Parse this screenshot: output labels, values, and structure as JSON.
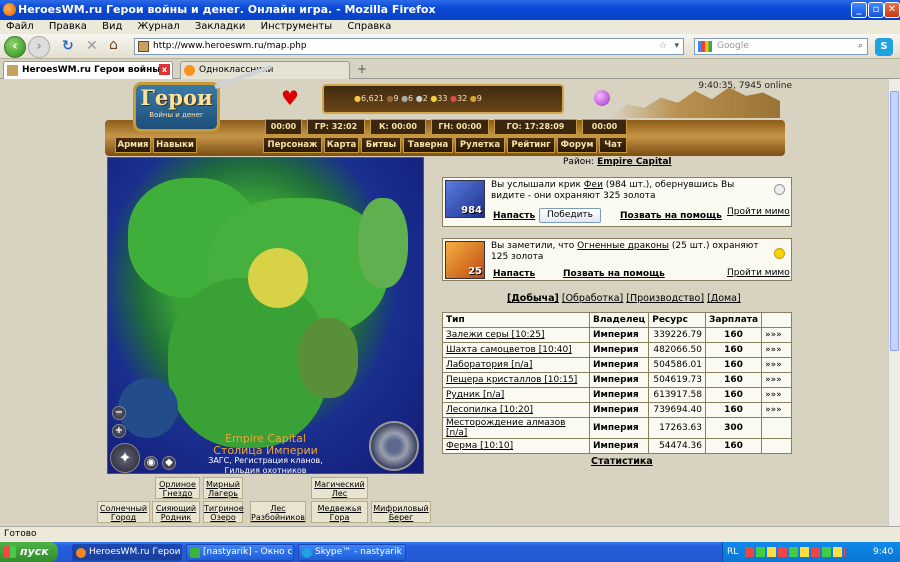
{
  "window": {
    "title": "HeroesWM.ru Герои войны и денег. Онлайн игра. - Mozilla Firefox"
  },
  "menu": [
    "Файл",
    "Правка",
    "Вид",
    "Журнал",
    "Закладки",
    "Инструменты",
    "Справка"
  ],
  "address": {
    "url": "http://www.heroeswm.ru/map.php"
  },
  "search": {
    "placeholder": "Google"
  },
  "tabs": [
    {
      "label": "HeroesWM.ru Герои войны и ден..."
    },
    {
      "label": "Одноклассники"
    }
  ],
  "header": {
    "logo_title": "Герои",
    "logo_sub": "Войны и денег",
    "resources": [
      "6,621",
      "9",
      "6",
      "2",
      "33",
      "32",
      "9"
    ],
    "clock": "9:40:35, 7945 online",
    "timers": [
      "00:00",
      "ГР: 32:02",
      "К: 00:00",
      "ГН: 00:00",
      "ГО: 17:28:09",
      "00:00"
    ],
    "left_nav": [
      "Армия",
      "Навыки"
    ],
    "nav": [
      "Персонаж",
      "Карта",
      "Битвы",
      "Таверна",
      "Рулетка",
      "Рейтинг",
      "Форум",
      "Чат"
    ]
  },
  "map": {
    "title1": "Empire Capital",
    "title2": "Столица Империи",
    "line3": "ЗАГС, Регистрация кланов,",
    "line4": "Гильдия охотников"
  },
  "districts": {
    "row1": [
      "Орлиное Гнездо",
      "Мирный Лагерь",
      "Магический Лес"
    ],
    "row2": [
      "Солнечный Город",
      "Сияющий Родник",
      "Тигриное Озеро",
      "Лес Разбойников",
      "Медвежья Гора",
      "Мифриловый Берег"
    ]
  },
  "region": {
    "label": "Район:",
    "name": "Empire Capital"
  },
  "encounters": [
    {
      "count": "984",
      "text_pre": "Вы услышали крик ",
      "creature": "Феи",
      "text_post": " (984 шт.), обернувшись Вы видите - они охраняют 325 золота",
      "attack": "Напасть",
      "win": "Победить",
      "help": "Позвать на помощь",
      "pass": "Пройти мимо"
    },
    {
      "count": "25",
      "text_pre": "Вы заметили, что ",
      "creature": "Огненные драконы",
      "text_post": " (25 шт.) охраняют 125 золота",
      "attack": "Напасть",
      "help": "Позвать на помощь",
      "pass": "Пройти мимо"
    }
  ],
  "work_tabs": [
    "[Добыча]",
    "[Обработка]",
    "[Производство]",
    "[Дома]"
  ],
  "table": {
    "headers": [
      "Тип",
      "Владелец",
      "Ресурс",
      "Зарплата",
      ""
    ],
    "rows": [
      [
        "Залежи серы  [10:25]",
        "Империя",
        "339226.79",
        "160",
        "»»»"
      ],
      [
        "Шахта самоцветов  [10:40]",
        "Империя",
        "482066.50",
        "160",
        "»»»"
      ],
      [
        "Лаборатория  [n/a]",
        "Империя",
        "504586.01",
        "160",
        "»»»"
      ],
      [
        "Пещера кристаллов  [10:15]",
        "Империя",
        "504619.73",
        "160",
        "»»»"
      ],
      [
        "Рудник  [n/a]",
        "Империя",
        "613917.58",
        "160",
        "»»»"
      ],
      [
        "Лесопилка  [10:20]",
        "Империя",
        "739694.40",
        "160",
        "»»»"
      ],
      [
        "Месторождение алмазов  [n/a]",
        "Империя",
        "17263.63",
        "300",
        ""
      ],
      [
        "Ферма  [10:10]",
        "Империя",
        "54474.36",
        "160",
        ""
      ]
    ]
  },
  "stats_link": "Статистика",
  "status": "Готово",
  "taskbar": {
    "start": "пуск",
    "items": [
      "HeroesWM.ru Герои ...",
      "[nastyarik] - Окно со...",
      "Skype™ - nastyarik"
    ],
    "lang": "RL",
    "time": "9:40"
  }
}
